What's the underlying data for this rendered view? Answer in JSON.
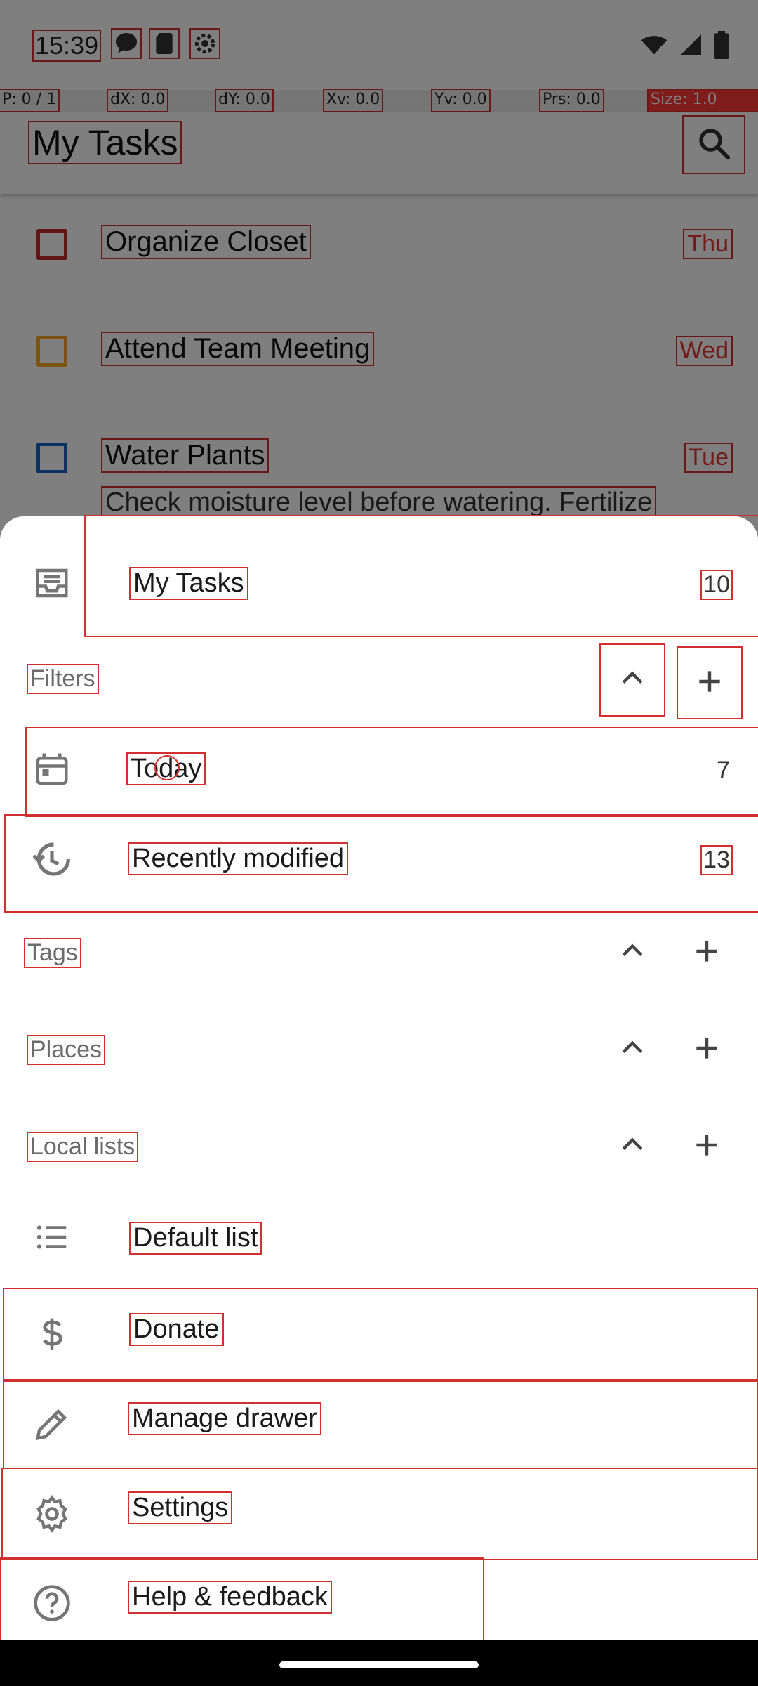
{
  "status_bar": {
    "time": "15:39"
  },
  "pointer_bar": {
    "p": "P: 0 / 1",
    "dx": "dX: 0.0",
    "dy": "dY: 0.0",
    "xv": "Xv: 0.0",
    "yv": "Yv: 0.0",
    "prs": "Prs: 0.0",
    "size": "Size: 1.0"
  },
  "toolbar": {
    "title": "My Tasks"
  },
  "tasks": [
    {
      "title": "Organize Closet",
      "date": "Thu",
      "color": "#c62828"
    },
    {
      "title": "Attend Team Meeting",
      "date": "Wed",
      "color": "#f9a825"
    },
    {
      "title": "Water Plants",
      "date": "Tue",
      "color": "#1565c0",
      "note": "Check moisture level before watering. Fertilize"
    }
  ],
  "drawer": {
    "my_tasks": {
      "label": "My Tasks",
      "count": "10"
    },
    "filters": {
      "header": "Filters",
      "items": [
        {
          "label": "Today",
          "count": "7"
        },
        {
          "label": "Recently modified",
          "count": "13"
        }
      ]
    },
    "tags_header": "Tags",
    "places_header": "Places",
    "local_lists": {
      "header": "Local lists",
      "items": [
        {
          "label": "Default list"
        }
      ]
    },
    "actions": [
      {
        "label": "Donate"
      },
      {
        "label": "Manage drawer"
      },
      {
        "label": "Settings"
      },
      {
        "label": "Help & feedback"
      }
    ]
  },
  "colors": {
    "accent": "#d32f2f",
    "icon": "#757575",
    "date_text": "#e53935"
  },
  "icons": [
    "chat-icon",
    "sd-card-icon",
    "settings-status-icon",
    "wifi-icon",
    "signal-icon",
    "battery-icon",
    "search-icon",
    "inbox-icon",
    "chevron-up-icon",
    "plus-icon",
    "calendar-icon",
    "history-icon",
    "list-icon",
    "dollar-icon",
    "pencil-icon",
    "gear-icon",
    "help-icon"
  ]
}
